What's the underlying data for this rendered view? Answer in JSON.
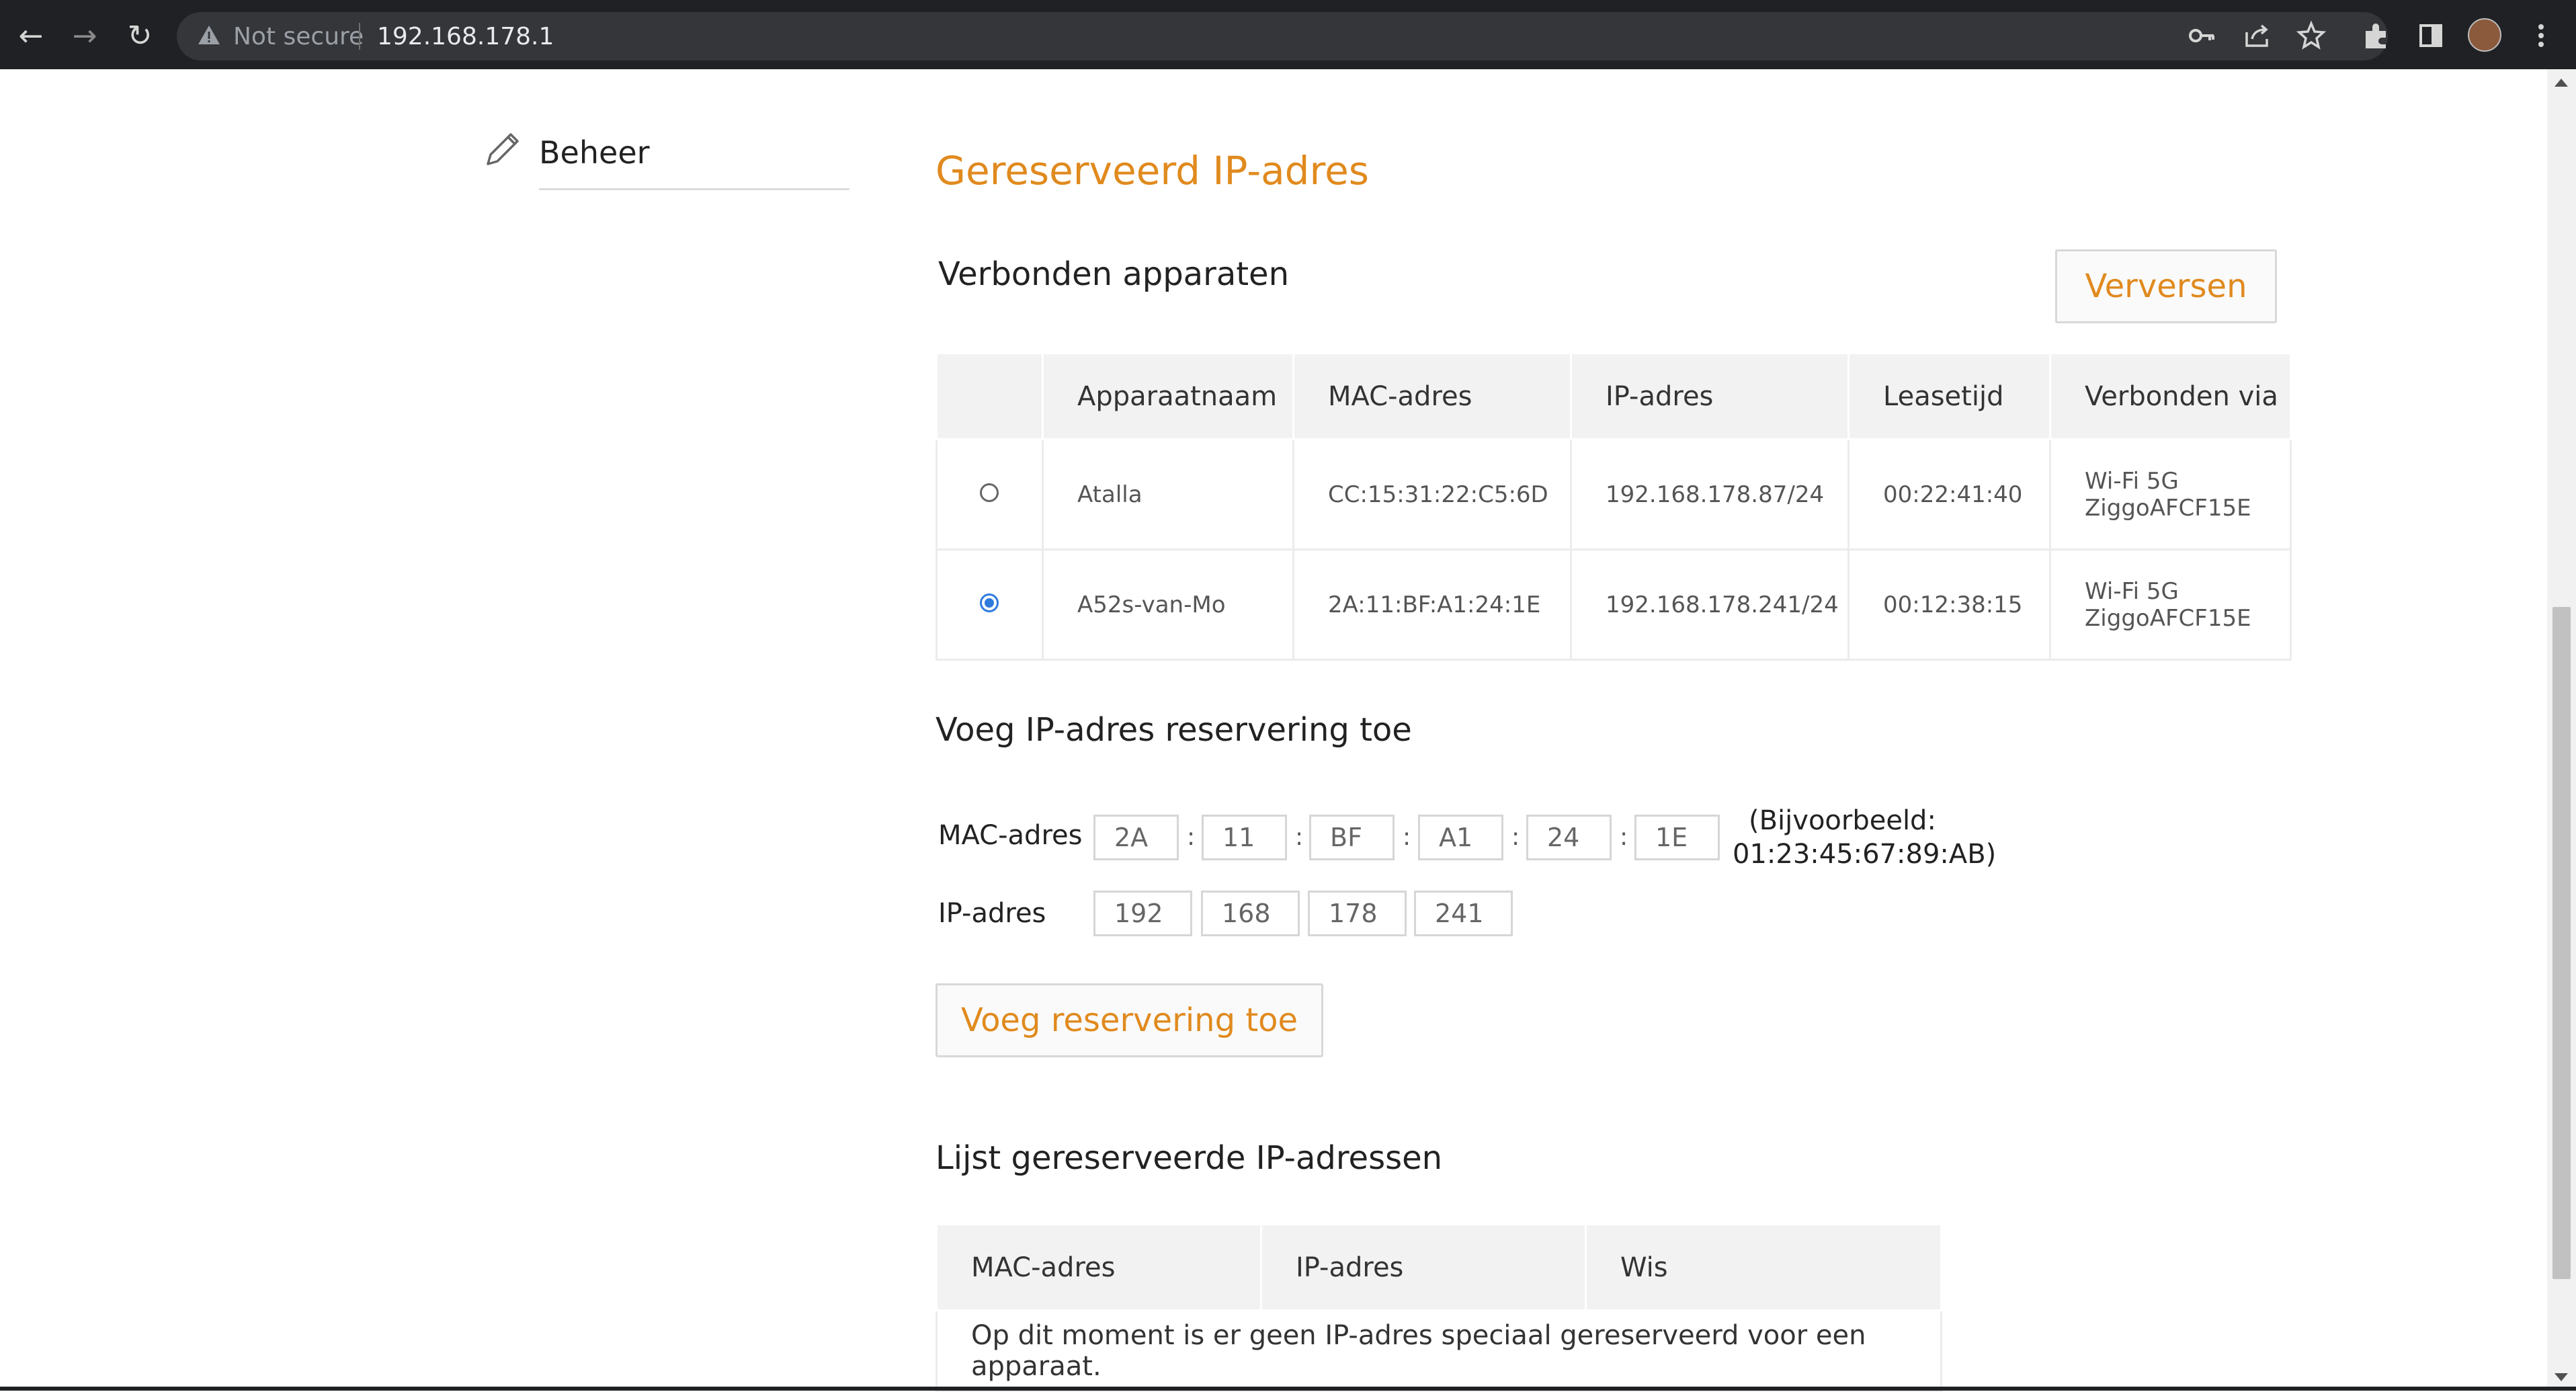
{
  "browser": {
    "security_label": "Not secure",
    "url": "192.168.178.1"
  },
  "sidebar": {
    "item_label": "Beheer"
  },
  "page": {
    "title": "Gereserveerd IP-adres",
    "connected": {
      "heading": "Verbonden apparaten",
      "refresh_label": "Verversen",
      "columns": [
        "Apparaatnaam",
        "MAC-adres",
        "IP-adres",
        "Leasetijd",
        "Verbonden via"
      ],
      "rows": [
        {
          "selected": false,
          "name": "Atalla",
          "mac": "CC:15:31:22:C5:6D",
          "ip": "192.168.178.87/24",
          "lease": "00:22:41:40",
          "via1": "Wi-Fi 5G",
          "via2": "ZiggoAFCF15E"
        },
        {
          "selected": true,
          "name": "A52s-van-Mo",
          "mac": "2A:11:BF:A1:24:1E",
          "ip": "192.168.178.241/24",
          "lease": "00:12:38:15",
          "via1": "Wi-Fi 5G",
          "via2": "ZiggoAFCF15E"
        }
      ]
    },
    "add": {
      "heading": "Voeg IP-adres reservering toe",
      "mac_label": "MAC-adres",
      "mac_parts": [
        "2A",
        "11",
        "BF",
        "A1",
        "24",
        "1E"
      ],
      "mac_separator": ":",
      "example_line1": "(Bijvoorbeeld:",
      "example_line2": "01:23:45:67:89:AB)",
      "ip_label": "IP-adres",
      "ip_parts": [
        "192",
        "168",
        "178",
        "241"
      ],
      "submit_label": "Voeg reservering toe"
    },
    "reserved": {
      "heading": "Lijst gereserveerde IP-adressen",
      "columns": [
        "MAC-adres",
        "IP-adres",
        "Wis"
      ],
      "empty_message": "Op dit moment is er geen IP-adres speciaal gereserveerd voor een apparaat."
    }
  },
  "colors": {
    "accent": "#e08a1e",
    "radio_selected": "#2f7bdc"
  }
}
